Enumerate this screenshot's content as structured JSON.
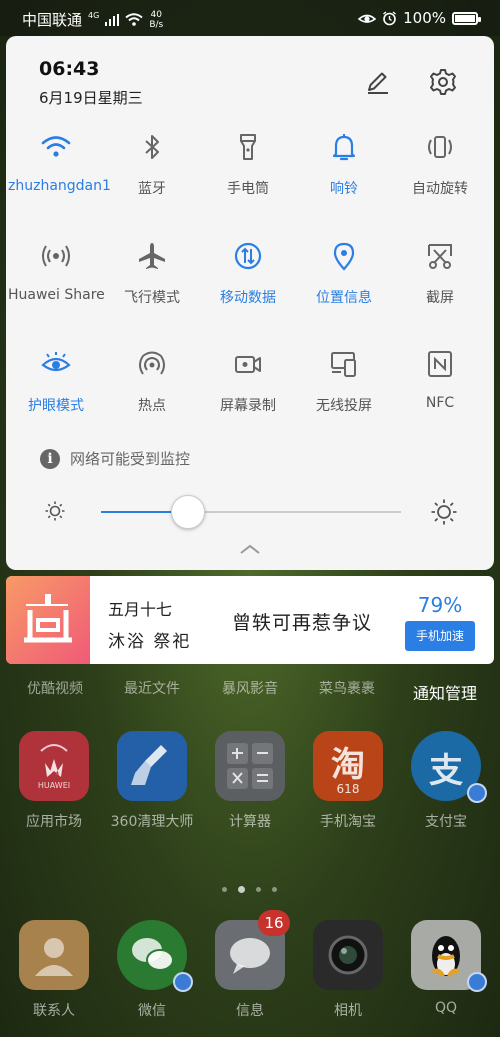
{
  "status_bar": {
    "carrier": "中国联通",
    "network_type": "4G",
    "net_speed_value": "40",
    "net_speed_unit": "B/s",
    "battery": "100%"
  },
  "header": {
    "time": "06:43",
    "date": "6月19日星期三"
  },
  "tiles": [
    {
      "label": "zhuzhangdan1",
      "icon": "wifi-icon",
      "on": true
    },
    {
      "label": "蓝牙",
      "icon": "bluetooth-icon",
      "on": false
    },
    {
      "label": "手电筒",
      "icon": "flashlight-icon",
      "on": false
    },
    {
      "label": "响铃",
      "icon": "bell-icon",
      "on": true
    },
    {
      "label": "自动旋转",
      "icon": "auto-rotate-icon",
      "on": false
    },
    {
      "label": "Huawei Share",
      "icon": "huawei-share-icon",
      "on": false
    },
    {
      "label": "飞行模式",
      "icon": "airplane-icon",
      "on": false
    },
    {
      "label": "移动数据",
      "icon": "mobile-data-icon",
      "on": true
    },
    {
      "label": "位置信息",
      "icon": "location-icon",
      "on": true
    },
    {
      "label": "截屏",
      "icon": "screenshot-icon",
      "on": false
    },
    {
      "label": "护眼模式",
      "icon": "eye-icon",
      "on": true
    },
    {
      "label": "热点",
      "icon": "hotspot-icon",
      "on": false
    },
    {
      "label": "屏幕录制",
      "icon": "screen-record-icon",
      "on": false
    },
    {
      "label": "无线投屏",
      "icon": "wireless-projection-icon",
      "on": false
    },
    {
      "label": "NFC",
      "icon": "nfc-icon",
      "on": false
    }
  ],
  "notice": "网络可能受到监控",
  "brightness": {
    "level": 0.29
  },
  "notification": {
    "line1": "五月十七",
    "line2": "沐浴 祭祀",
    "message": "曾轶可再惹争议",
    "percent": "79%",
    "button": "手机加速"
  },
  "notification_manage": "通知管理",
  "home_row_labels": [
    "优酷视频",
    "最近文件",
    "暴风影音",
    "菜鸟裹裹"
  ],
  "apps": [
    {
      "label": "应用市场",
      "icon": "huawei-appgallery-icon",
      "icon_text": "HUAWEI",
      "color": "#d8343f"
    },
    {
      "label": "360清理大师",
      "icon": "broom-icon",
      "color": "#2f8de4"
    },
    {
      "label": "计算器",
      "icon": "calculator-icon",
      "color": "#8a8f94"
    },
    {
      "label": "手机淘宝",
      "icon": "taobao-icon",
      "icon_text": "淘",
      "icon_subtext": "618",
      "color": "#f55a1e"
    },
    {
      "label": "支付宝",
      "icon": "alipay-icon",
      "icon_text": "支",
      "color": "#1f8bdc"
    }
  ],
  "dock": [
    {
      "label": "联系人",
      "icon": "contacts-icon",
      "color": "#f0c07a"
    },
    {
      "label": "微信",
      "icon": "wechat-icon",
      "color": "#3fb448"
    },
    {
      "label": "信息",
      "icon": "messages-icon",
      "color": "#9aa0a6",
      "badge": "16"
    },
    {
      "label": "相机",
      "icon": "camera-icon",
      "color": "#3a3a3a"
    },
    {
      "label": "QQ",
      "icon": "qq-icon",
      "color": "#f2f2f2"
    }
  ]
}
